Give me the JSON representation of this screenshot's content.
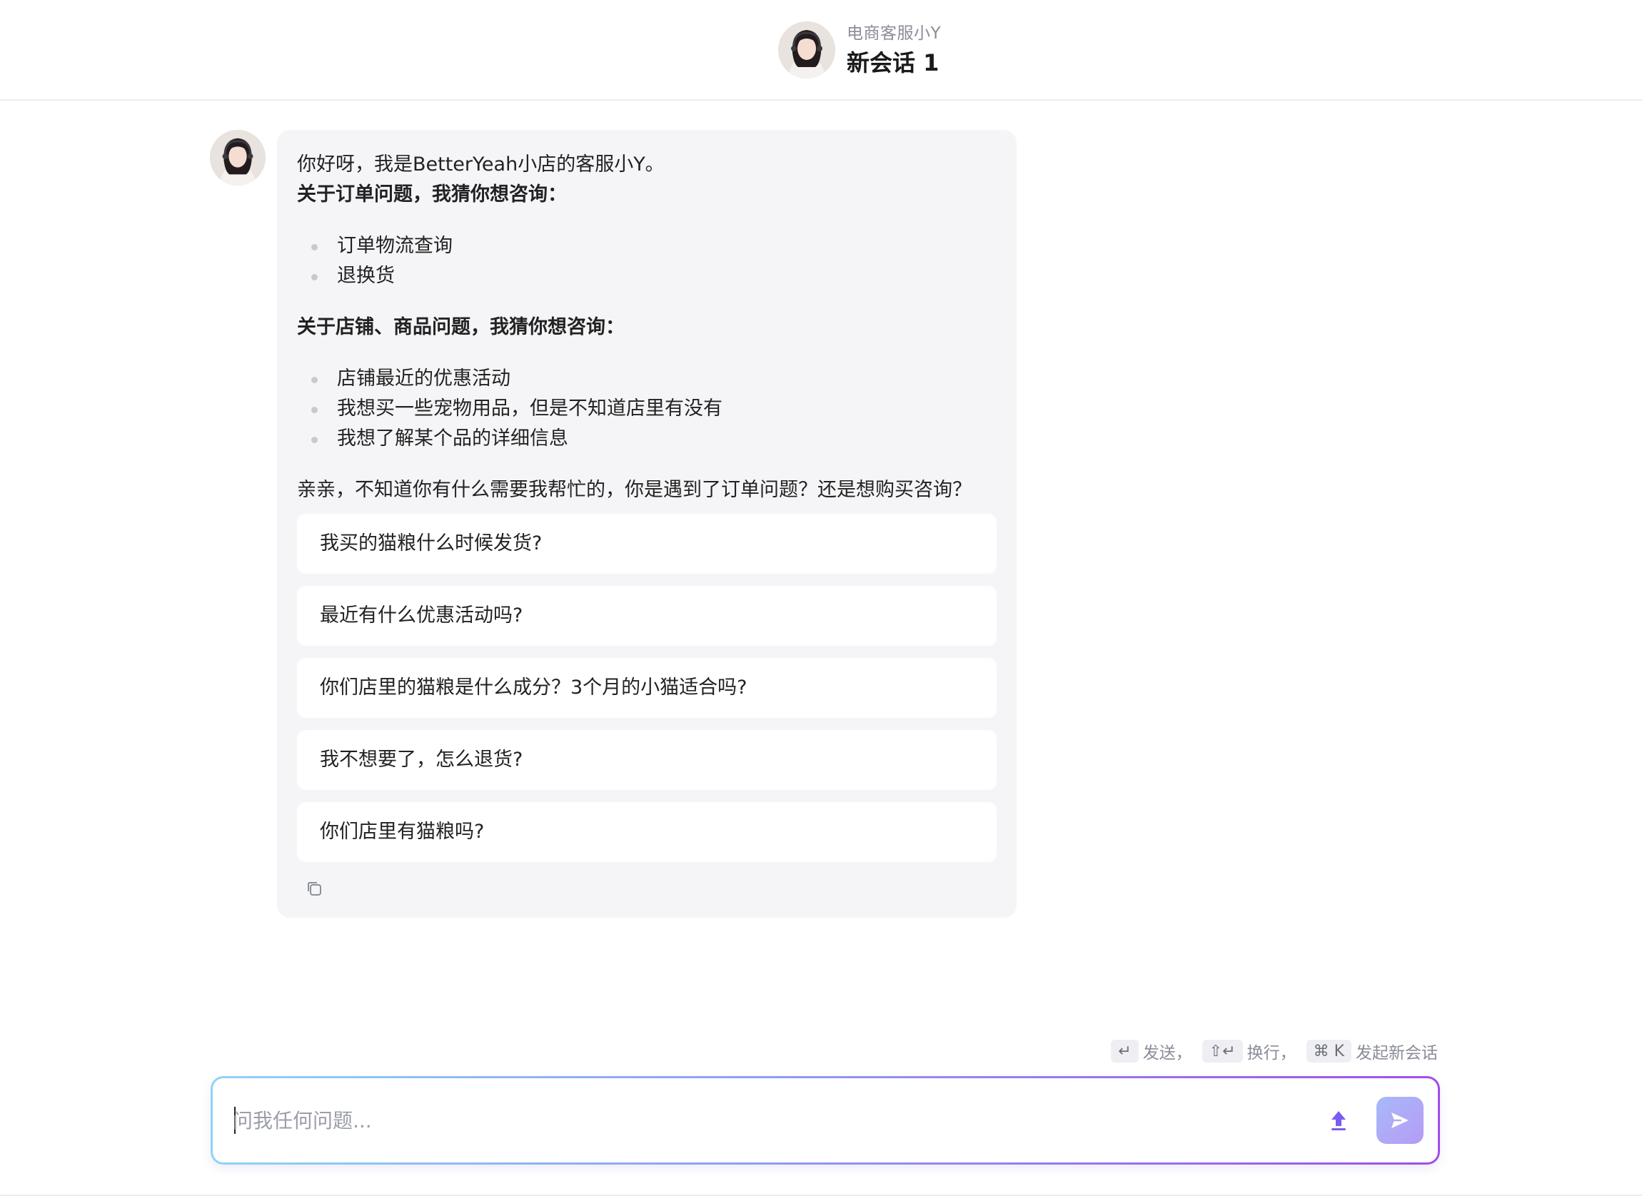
{
  "header": {
    "bot_name": "电商客服小Y",
    "session_title": "新会话 1"
  },
  "message": {
    "greeting": "你好呀，我是BetterYeah小店的客服小Y。",
    "order_heading": "关于订单问题，我猜你想咨询：",
    "order_items": [
      "订单物流查询",
      "退换货"
    ],
    "shop_heading": "关于店铺、商品问题，我猜你想咨询：",
    "shop_items": [
      "店铺最近的优惠活动",
      "我想买一些宠物用品，但是不知道店里有没有",
      "我想了解某个品的详细信息"
    ],
    "closing": "亲亲，不知道你有什么需要我帮忙的，你是遇到了订单问题？还是想购买咨询？",
    "suggestions": [
      "我买的猫粮什么时候发货?",
      "最近有什么优惠活动吗?",
      "你们店里的猫粮是什么成分？3个月的小猫适合吗?",
      "我不想要了，怎么退货?",
      "你们店里有猫粮吗?"
    ]
  },
  "hints": {
    "enter_key": "↵",
    "send": "发送，",
    "shift_enter_key": "⇧↵",
    "newline": "换行，",
    "cmd_k_key": "⌘  K",
    "new_session": "发起新会话"
  },
  "input": {
    "placeholder": "问我任何问题...",
    "value": ""
  },
  "colors": {
    "accent": "#7b5cf0",
    "bubble_bg": "#f5f5f8"
  }
}
